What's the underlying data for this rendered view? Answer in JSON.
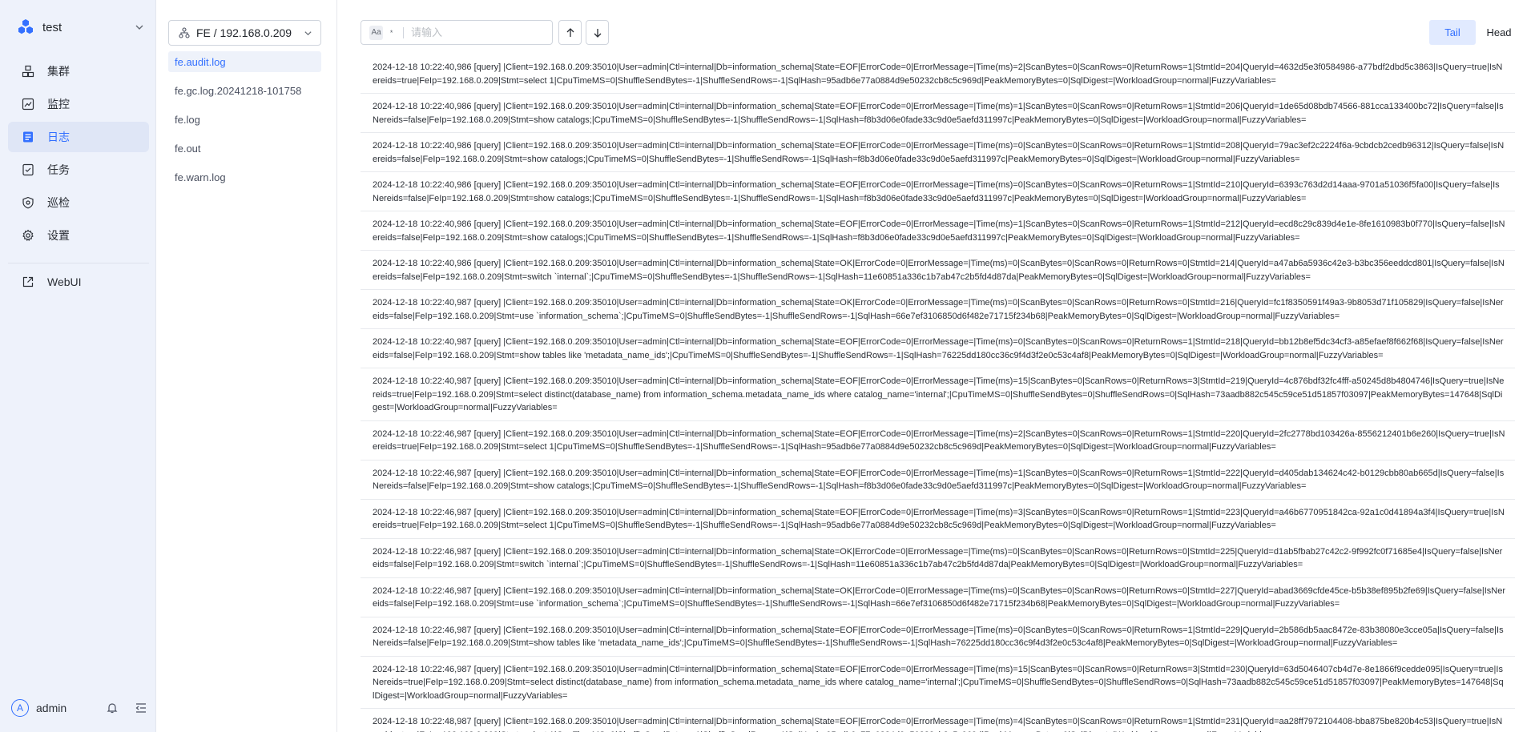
{
  "app": {
    "cluster_name": "test",
    "accent_color": "#3370ff",
    "sidebar_bg": "#eef2fb"
  },
  "sidebar": {
    "items": [
      {
        "label": "集群",
        "icon": "cluster-icon"
      },
      {
        "label": "监控",
        "icon": "monitor-chart-icon"
      },
      {
        "label": "日志",
        "icon": "log-document-icon",
        "active": true
      },
      {
        "label": "任务",
        "icon": "task-icon"
      },
      {
        "label": "巡检",
        "icon": "inspection-shield-icon"
      },
      {
        "label": "设置",
        "icon": "gear-icon"
      }
    ],
    "webui_label": "WebUI",
    "user": {
      "avatar_letter": "A",
      "name": "admin"
    }
  },
  "files": {
    "node_selector": "FE / 192.168.0.209",
    "items": [
      {
        "label": "fe.audit.log",
        "active": true
      },
      {
        "label": "fe.gc.log.20241218-101758"
      },
      {
        "label": "fe.log"
      },
      {
        "label": "fe.out"
      },
      {
        "label": "fe.warn.log"
      }
    ]
  },
  "toolbar": {
    "case_label": "Aa",
    "regex_label": "*",
    "search_placeholder": "请输入",
    "tail_label": "Tail",
    "head_label": "Head",
    "active_mode": "Tail"
  },
  "logs": [
    "2024-12-18 10:22:40,986 [query] |Client=192.168.0.209:35010|User=admin|Ctl=internal|Db=information_schema|State=EOF|ErrorCode=0|ErrorMessage=|Time(ms)=2|ScanBytes=0|ScanRows=0|ReturnRows=1|StmtId=204|QueryId=4632d5e3f0584986-a77bdf2dbd5c3863|IsQuery=true|IsNereids=true|FeIp=192.168.0.209|Stmt=select 1|CpuTimeMS=0|ShuffleSendBytes=-1|ShuffleSendRows=-1|SqlHash=95adb6e77a0884d9e50232cb8c5c969d|PeakMemoryBytes=0|SqlDigest=|WorkloadGroup=normal|FuzzyVariables=",
    "2024-12-18 10:22:40,986 [query] |Client=192.168.0.209:35010|User=admin|Ctl=internal|Db=information_schema|State=EOF|ErrorCode=0|ErrorMessage=|Time(ms)=1|ScanBytes=0|ScanRows=0|ReturnRows=1|StmtId=206|QueryId=1de65d08bdb74566-881cca133400bc72|IsQuery=false|IsNereids=false|FeIp=192.168.0.209|Stmt=show catalogs;|CpuTimeMS=0|ShuffleSendBytes=-1|ShuffleSendRows=-1|SqlHash=f8b3d06e0fade33c9d0e5aefd311997c|PeakMemoryBytes=0|SqlDigest=|WorkloadGroup=normal|FuzzyVariables=",
    "2024-12-18 10:22:40,986 [query] |Client=192.168.0.209:35010|User=admin|Ctl=internal|Db=information_schema|State=EOF|ErrorCode=0|ErrorMessage=|Time(ms)=0|ScanBytes=0|ScanRows=0|ReturnRows=1|StmtId=208|QueryId=79ac3ef2c2224f6a-9cbdcb2cedb96312|IsQuery=false|IsNereids=false|FeIp=192.168.0.209|Stmt=show catalogs;|CpuTimeMS=0|ShuffleSendBytes=-1|ShuffleSendRows=-1|SqlHash=f8b3d06e0fade33c9d0e5aefd311997c|PeakMemoryBytes=0|SqlDigest=|WorkloadGroup=normal|FuzzyVariables=",
    "2024-12-18 10:22:40,986 [query] |Client=192.168.0.209:35010|User=admin|Ctl=internal|Db=information_schema|State=EOF|ErrorCode=0|ErrorMessage=|Time(ms)=0|ScanBytes=0|ScanRows=0|ReturnRows=1|StmtId=210|QueryId=6393c763d2d14aaa-9701a51036f5fa00|IsQuery=false|IsNereids=false|FeIp=192.168.0.209|Stmt=show catalogs;|CpuTimeMS=0|ShuffleSendBytes=-1|ShuffleSendRows=-1|SqlHash=f8b3d06e0fade33c9d0e5aefd311997c|PeakMemoryBytes=0|SqlDigest=|WorkloadGroup=normal|FuzzyVariables=",
    "2024-12-18 10:22:40,986 [query] |Client=192.168.0.209:35010|User=admin|Ctl=internal|Db=information_schema|State=EOF|ErrorCode=0|ErrorMessage=|Time(ms)=1|ScanBytes=0|ScanRows=0|ReturnRows=1|StmtId=212|QueryId=ecd8c29c839d4e1e-8fe1610983b0f770|IsQuery=false|IsNereids=false|FeIp=192.168.0.209|Stmt=show catalogs;|CpuTimeMS=0|ShuffleSendBytes=-1|ShuffleSendRows=-1|SqlHash=f8b3d06e0fade33c9d0e5aefd311997c|PeakMemoryBytes=0|SqlDigest=|WorkloadGroup=normal|FuzzyVariables=",
    "2024-12-18 10:22:40,986 [query] |Client=192.168.0.209:35010|User=admin|Ctl=internal|Db=information_schema|State=OK|ErrorCode=0|ErrorMessage=|Time(ms)=0|ScanBytes=0|ScanRows=0|ReturnRows=0|StmtId=214|QueryId=a47ab6a5936c42e3-b3bc356eeddcd801|IsQuery=false|IsNereids=false|FeIp=192.168.0.209|Stmt=switch `internal`;|CpuTimeMS=0|ShuffleSendBytes=-1|ShuffleSendRows=-1|SqlHash=11e60851a336c1b7ab47c2b5fd4d87da|PeakMemoryBytes=0|SqlDigest=|WorkloadGroup=normal|FuzzyVariables=",
    "2024-12-18 10:22:40,987 [query] |Client=192.168.0.209:35010|User=admin|Ctl=internal|Db=information_schema|State=OK|ErrorCode=0|ErrorMessage=|Time(ms)=0|ScanBytes=0|ScanRows=0|ReturnRows=0|StmtId=216|QueryId=fc1f8350591f49a3-9b8053d71f105829|IsQuery=false|IsNereids=false|FeIp=192.168.0.209|Stmt=use `information_schema`;|CpuTimeMS=0|ShuffleSendBytes=-1|ShuffleSendRows=-1|SqlHash=66e7ef3106850d6f482e71715f234b68|PeakMemoryBytes=0|SqlDigest=|WorkloadGroup=normal|FuzzyVariables=",
    "2024-12-18 10:22:40,987 [query] |Client=192.168.0.209:35010|User=admin|Ctl=internal|Db=information_schema|State=EOF|ErrorCode=0|ErrorMessage=|Time(ms)=0|ScanBytes=0|ScanRows=0|ReturnRows=1|StmtId=218|QueryId=bb12b8ef5dc34cf3-a85efaef8f662f68|IsQuery=false|IsNereids=false|FeIp=192.168.0.209|Stmt=show tables like 'metadata_name_ids';|CpuTimeMS=0|ShuffleSendBytes=-1|ShuffleSendRows=-1|SqlHash=76225dd180cc36c9f4d3f2e0c53c4af8|PeakMemoryBytes=0|SqlDigest=|WorkloadGroup=normal|FuzzyVariables=",
    "2024-12-18 10:22:40,987 [query] |Client=192.168.0.209:35010|User=admin|Ctl=internal|Db=information_schema|State=EOF|ErrorCode=0|ErrorMessage=|Time(ms)=15|ScanBytes=0|ScanRows=0|ReturnRows=3|StmtId=219|QueryId=4c876bdf32fc4fff-a50245d8b4804746|IsQuery=true|IsNereids=true|FeIp=192.168.0.209|Stmt=select distinct(database_name) from information_schema.metadata_name_ids where catalog_name='internal';|CpuTimeMS=0|ShuffleSendBytes=0|ShuffleSendRows=0|SqlHash=73aadb882c545c59ce51d51857f03097|PeakMemoryBytes=147648|SqlDigest=|WorkloadGroup=normal|FuzzyVariables=",
    "2024-12-18 10:22:46,987 [query] |Client=192.168.0.209:35010|User=admin|Ctl=internal|Db=information_schema|State=EOF|ErrorCode=0|ErrorMessage=|Time(ms)=2|ScanBytes=0|ScanRows=0|ReturnRows=1|StmtId=220|QueryId=2fc2778bd103426a-8556212401b6e260|IsQuery=true|IsNereids=true|FeIp=192.168.0.209|Stmt=select 1|CpuTimeMS=0|ShuffleSendBytes=-1|ShuffleSendRows=-1|SqlHash=95adb6e77a0884d9e50232cb8c5c969d|PeakMemoryBytes=0|SqlDigest=|WorkloadGroup=normal|FuzzyVariables=",
    "2024-12-18 10:22:46,987 [query] |Client=192.168.0.209:35010|User=admin|Ctl=internal|Db=information_schema|State=EOF|ErrorCode=0|ErrorMessage=|Time(ms)=1|ScanBytes=0|ScanRows=0|ReturnRows=1|StmtId=222|QueryId=d405dab134624c42-b0129cbb80ab665d|IsQuery=false|IsNereids=false|FeIp=192.168.0.209|Stmt=show catalogs;|CpuTimeMS=0|ShuffleSendBytes=-1|ShuffleSendRows=-1|SqlHash=f8b3d06e0fade33c9d0e5aefd311997c|PeakMemoryBytes=0|SqlDigest=|WorkloadGroup=normal|FuzzyVariables=",
    "2024-12-18 10:22:46,987 [query] |Client=192.168.0.209:35010|User=admin|Ctl=internal|Db=information_schema|State=EOF|ErrorCode=0|ErrorMessage=|Time(ms)=3|ScanBytes=0|ScanRows=0|ReturnRows=1|StmtId=223|QueryId=a46b6770951842ca-92a1c0d41894a3f4|IsQuery=true|IsNereids=true|FeIp=192.168.0.209|Stmt=select 1|CpuTimeMS=0|ShuffleSendBytes=-1|ShuffleSendRows=-1|SqlHash=95adb6e77a0884d9e50232cb8c5c969d|PeakMemoryBytes=0|SqlDigest=|WorkloadGroup=normal|FuzzyVariables=",
    "2024-12-18 10:22:46,987 [query] |Client=192.168.0.209:35010|User=admin|Ctl=internal|Db=information_schema|State=OK|ErrorCode=0|ErrorMessage=|Time(ms)=0|ScanBytes=0|ScanRows=0|ReturnRows=0|StmtId=225|QueryId=d1ab5fbab27c42c2-9f992fc0f71685e4|IsQuery=false|IsNereids=false|FeIp=192.168.0.209|Stmt=switch `internal`;|CpuTimeMS=0|ShuffleSendBytes=-1|ShuffleSendRows=-1|SqlHash=11e60851a336c1b7ab47c2b5fd4d87da|PeakMemoryBytes=0|SqlDigest=|WorkloadGroup=normal|FuzzyVariables=",
    "2024-12-18 10:22:46,987 [query] |Client=192.168.0.209:35010|User=admin|Ctl=internal|Db=information_schema|State=OK|ErrorCode=0|ErrorMessage=|Time(ms)=0|ScanBytes=0|ScanRows=0|ReturnRows=0|StmtId=227|QueryId=abad3669cfde45ce-b5b38ef895b2fe69|IsQuery=false|IsNereids=false|FeIp=192.168.0.209|Stmt=use `information_schema`;|CpuTimeMS=0|ShuffleSendBytes=-1|ShuffleSendRows=-1|SqlHash=66e7ef3106850d6f482e71715f234b68|PeakMemoryBytes=0|SqlDigest=|WorkloadGroup=normal|FuzzyVariables=",
    "2024-12-18 10:22:46,987 [query] |Client=192.168.0.209:35010|User=admin|Ctl=internal|Db=information_schema|State=EOF|ErrorCode=0|ErrorMessage=|Time(ms)=0|ScanBytes=0|ScanRows=0|ReturnRows=1|StmtId=229|QueryId=2b586db5aac8472e-83b38080e3cce05a|IsQuery=false|IsNereids=false|FeIp=192.168.0.209|Stmt=show tables like 'metadata_name_ids';|CpuTimeMS=0|ShuffleSendBytes=-1|ShuffleSendRows=-1|SqlHash=76225dd180cc36c9f4d3f2e0c53c4af8|PeakMemoryBytes=0|SqlDigest=|WorkloadGroup=normal|FuzzyVariables=",
    "2024-12-18 10:22:46,987 [query] |Client=192.168.0.209:35010|User=admin|Ctl=internal|Db=information_schema|State=EOF|ErrorCode=0|ErrorMessage=|Time(ms)=15|ScanBytes=0|ScanRows=0|ReturnRows=3|StmtId=230|QueryId=63d5046407cb4d7e-8e1866f9cedde095|IsQuery=true|IsNereids=true|FeIp=192.168.0.209|Stmt=select distinct(database_name) from information_schema.metadata_name_ids where catalog_name='internal';|CpuTimeMS=0|ShuffleSendBytes=0|ShuffleSendRows=0|SqlHash=73aadb882c545c59ce51d51857f03097|PeakMemoryBytes=147648|SqlDigest=|WorkloadGroup=normal|FuzzyVariables=",
    "2024-12-18 10:22:48,987 [query] |Client=192.168.0.209:35010|User=admin|Ctl=internal|Db=information_schema|State=EOF|ErrorCode=0|ErrorMessage=|Time(ms)=4|ScanBytes=0|ScanRows=0|ReturnRows=1|StmtId=231|QueryId=aa28ff7972104408-bba875be820b4c53|IsQuery=true|IsNereids=true|FeIp=192.168.0.209|Stmt=select 1|CpuTimeMS=0|ShuffleSendBytes=-1|ShuffleSendRows=-1|SqlHash=95adb6e77a0884d9e50232cb8c5c969d|PeakMemoryBytes=0|SqlDigest=|WorkloadGroup=normal|FuzzyVariables="
  ]
}
